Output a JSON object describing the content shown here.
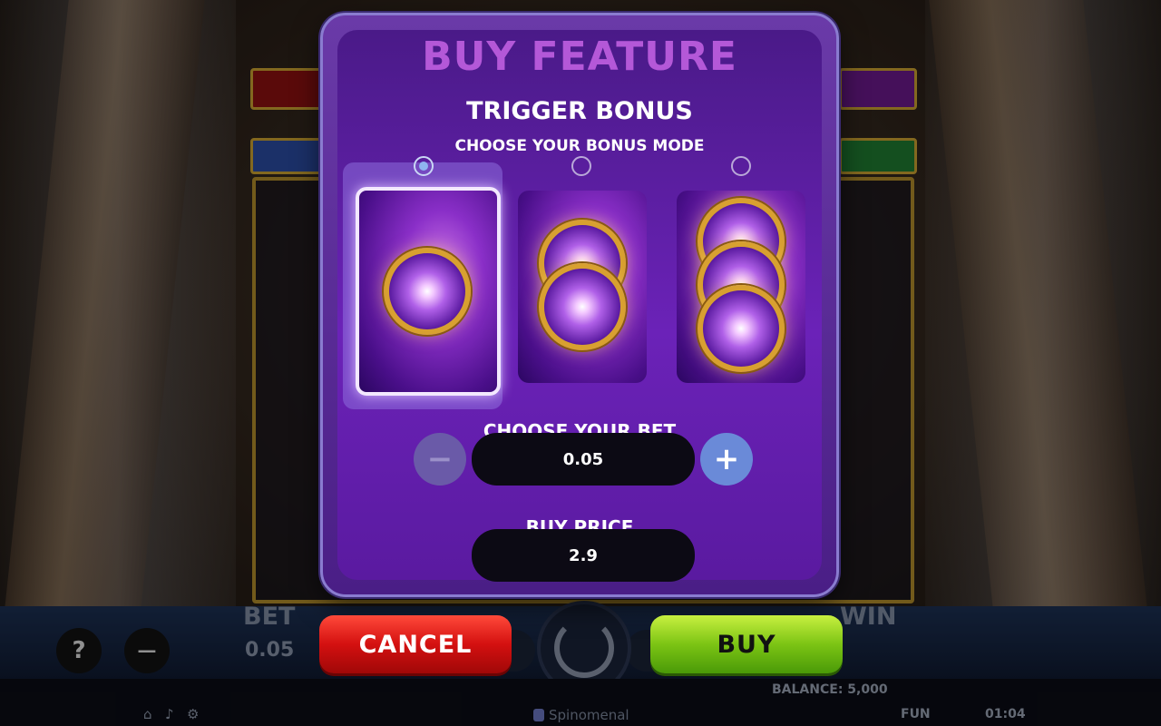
{
  "modal": {
    "title": "BUY FEATURE",
    "subtitle": "TRIGGER BONUS",
    "choose_mode_label": "CHOOSE YOUR BONUS MODE",
    "modes": [
      {
        "selected": true,
        "orbs": 1
      },
      {
        "selected": false,
        "orbs": 2
      },
      {
        "selected": false,
        "orbs": 3
      }
    ],
    "choose_bet_label": "CHOOSE YOUR BET",
    "bet_value": "0.05",
    "buy_price_label": "BUY PRICE",
    "buy_price_value": "2.9",
    "minus_icon": "−",
    "plus_icon": "+",
    "cancel_label": "CANCEL",
    "buy_label": "BUY"
  },
  "hud": {
    "bet_label": "BET",
    "bet_value": "0.05",
    "win_label": "WIN",
    "help_icon": "?",
    "minus_icon": "−",
    "balance": "BALANCE: 5,000",
    "mode": "FUN",
    "clock": "01:04",
    "brand": "Spinomenal"
  },
  "colors": {
    "title": "#b458d8",
    "cancel": "#d41010",
    "buy": "#7cc414",
    "modal_bg": "#5a1aa0"
  }
}
